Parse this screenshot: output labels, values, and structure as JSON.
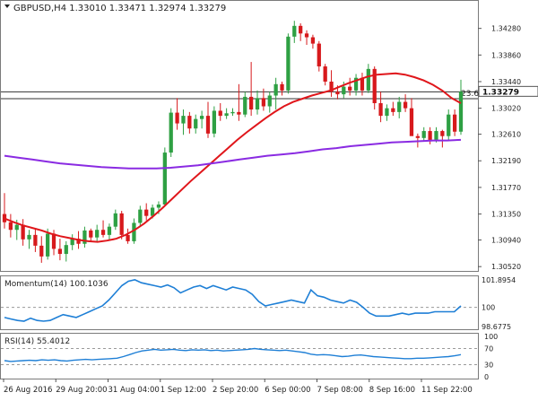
{
  "header": {
    "symbol_line": "GBPUSD,H4  1.33010 1.33471 1.32974 1.33279"
  },
  "fib_label": "23.6",
  "current_price": "1.33279",
  "price_axis": [
    "1.34280",
    "1.33860",
    "1.33440",
    "1.33020",
    "1.32610",
    "1.32190",
    "1.31770",
    "1.31350",
    "1.30940",
    "1.30520"
  ],
  "time_axis": [
    "26 Aug 2016",
    "29 Aug 20:00",
    "31 Aug 04:00",
    "1 Sep 12:00",
    "2 Sep 20:00",
    "6 Sep 00:00",
    "7 Sep 08:00",
    "8 Sep 16:00",
    "11 Sep 22:00"
  ],
  "momentum": {
    "label": "Momentum(14) 100.1036",
    "axis": [
      "101.8954",
      "100",
      "98.6775"
    ]
  },
  "rsi": {
    "label": "RSI(14) 55.4012",
    "axis": [
      "100",
      "70",
      "30",
      "0"
    ]
  },
  "colors": {
    "bull": "#2ea043",
    "bear": "#d7191c",
    "sma_fast": "#e0161b",
    "sma_slow": "#8a2be2",
    "indicator": "#1e7fd6",
    "grid": "#9a9a9a",
    "axis_text": "#222222"
  },
  "chart_data": [
    {
      "type": "candlestick",
      "title": "GBPUSD,H4",
      "ohlc_header": {
        "open": 1.3301,
        "high": 1.33471,
        "low": 1.32974,
        "close": 1.33279
      },
      "ylim": [
        1.3048,
        1.347
      ],
      "y_ticks": [
        1.3428,
        1.3386,
        1.3344,
        1.3302,
        1.3261,
        1.3219,
        1.3177,
        1.3135,
        1.3094,
        1.3052
      ],
      "x_tick_labels": [
        "26 Aug 2016",
        "29 Aug 20:00",
        "31 Aug 04:00",
        "1 Sep 12:00",
        "2 Sep 20:00",
        "6 Sep 00:00",
        "7 Sep 08:00",
        "8 Sep 16:00",
        "11 Sep 22:00"
      ],
      "fib_level": {
        "label": "23.6",
        "value": 1.3317
      },
      "last_price_line": 1.33279,
      "candles": [
        [
          1.3135,
          1.3168,
          1.3112,
          1.3122
        ],
        [
          1.3122,
          1.3135,
          1.3098,
          1.311
        ],
        [
          1.311,
          1.3126,
          1.3094,
          1.3118
        ],
        [
          1.3118,
          1.3127,
          1.3085,
          1.3095
        ],
        [
          1.3095,
          1.311,
          1.308,
          1.3102
        ],
        [
          1.3102,
          1.3112,
          1.3075,
          1.3085
        ],
        [
          1.3085,
          1.31,
          1.3058,
          1.3068
        ],
        [
          1.3068,
          1.3112,
          1.3063,
          1.3104
        ],
        [
          1.3104,
          1.311,
          1.307,
          1.308
        ],
        [
          1.308,
          1.3096,
          1.3062,
          1.3072
        ],
        [
          1.3072,
          1.3092,
          1.306,
          1.3086
        ],
        [
          1.3086,
          1.3103,
          1.3078,
          1.3096
        ],
        [
          1.3096,
          1.3108,
          1.308,
          1.3088
        ],
        [
          1.3088,
          1.3115,
          1.3082,
          1.3109
        ],
        [
          1.3109,
          1.3112,
          1.3092,
          1.3098
        ],
        [
          1.3098,
          1.3118,
          1.309,
          1.311
        ],
        [
          1.311,
          1.3125,
          1.3098,
          1.3102
        ],
        [
          1.3102,
          1.312,
          1.3094,
          1.3115
        ],
        [
          1.3115,
          1.3142,
          1.311,
          1.3136
        ],
        [
          1.3136,
          1.314,
          1.3095,
          1.3102
        ],
        [
          1.3102,
          1.3112,
          1.3088,
          1.3092
        ],
        [
          1.3092,
          1.3128,
          1.3088,
          1.3121
        ],
        [
          1.3121,
          1.3148,
          1.3115,
          1.3142
        ],
        [
          1.3142,
          1.3152,
          1.3125,
          1.3132
        ],
        [
          1.3132,
          1.315,
          1.3128,
          1.3145
        ],
        [
          1.3145,
          1.3155,
          1.3135,
          1.315
        ],
        [
          1.315,
          1.324,
          1.3148,
          1.3232
        ],
        [
          1.3232,
          1.3302,
          1.3225,
          1.3295
        ],
        [
          1.3295,
          1.3318,
          1.3268,
          1.3278
        ],
        [
          1.3278,
          1.33,
          1.326,
          1.329
        ],
        [
          1.329,
          1.3296,
          1.3262,
          1.327
        ],
        [
          1.327,
          1.3292,
          1.3262,
          1.3285
        ],
        [
          1.3285,
          1.3298,
          1.327,
          1.329
        ],
        [
          1.329,
          1.3312,
          1.3255,
          1.3262
        ],
        [
          1.3262,
          1.3305,
          1.3256,
          1.3298
        ],
        [
          1.3298,
          1.331,
          1.3282,
          1.329
        ],
        [
          1.329,
          1.3302,
          1.3285,
          1.3294
        ],
        [
          1.3294,
          1.3302,
          1.329,
          1.3296
        ],
        [
          1.3296,
          1.334,
          1.3282,
          1.3292
        ],
        [
          1.3292,
          1.3328,
          1.3288,
          1.332
        ],
        [
          1.332,
          1.3375,
          1.329,
          1.33
        ],
        [
          1.33,
          1.333,
          1.3292,
          1.3318
        ],
        [
          1.3318,
          1.3333,
          1.3298,
          1.3305
        ],
        [
          1.3305,
          1.3328,
          1.3295,
          1.3322
        ],
        [
          1.3322,
          1.335,
          1.33,
          1.334
        ],
        [
          1.334,
          1.3344,
          1.3322,
          1.333
        ],
        [
          1.333,
          1.342,
          1.3325,
          1.3415
        ],
        [
          1.3415,
          1.344,
          1.3405,
          1.3432
        ],
        [
          1.3432,
          1.3436,
          1.3408,
          1.342
        ],
        [
          1.342,
          1.3425,
          1.3402,
          1.3414
        ],
        [
          1.3414,
          1.3418,
          1.3396,
          1.3404
        ],
        [
          1.3404,
          1.3408,
          1.336,
          1.3368
        ],
        [
          1.3368,
          1.3372,
          1.3338,
          1.3344
        ],
        [
          1.3344,
          1.3362,
          1.332,
          1.3328
        ],
        [
          1.3328,
          1.3338,
          1.3316,
          1.3324
        ],
        [
          1.3324,
          1.3344,
          1.3318,
          1.3336
        ],
        [
          1.3336,
          1.335,
          1.3322,
          1.333
        ],
        [
          1.333,
          1.3356,
          1.3322,
          1.335
        ],
        [
          1.335,
          1.3358,
          1.3322,
          1.333
        ],
        [
          1.333,
          1.3372,
          1.3326,
          1.3364
        ],
        [
          1.3364,
          1.3368,
          1.33,
          1.331
        ],
        [
          1.331,
          1.3328,
          1.328,
          1.329
        ],
        [
          1.329,
          1.3308,
          1.3282,
          1.3302
        ],
        [
          1.3302,
          1.3312,
          1.329,
          1.3296
        ],
        [
          1.3296,
          1.332,
          1.3286,
          1.3312
        ],
        [
          1.3312,
          1.3324,
          1.3296,
          1.3302
        ],
        [
          1.3302,
          1.3318,
          1.327,
          1.3258
        ],
        [
          1.3258,
          1.3262,
          1.324,
          1.3255
        ],
        [
          1.3255,
          1.3272,
          1.325,
          1.3266
        ],
        [
          1.3266,
          1.3272,
          1.3245,
          1.3252
        ],
        [
          1.3252,
          1.3272,
          1.3248,
          1.3266
        ],
        [
          1.3266,
          1.3268,
          1.324,
          1.3258
        ],
        [
          1.3258,
          1.33,
          1.325,
          1.3292
        ],
        [
          1.3292,
          1.33,
          1.3258,
          1.3265
        ],
        [
          1.3265,
          1.3347,
          1.326,
          1.3328
        ]
      ],
      "series": [
        {
          "values": [
            1.3128,
            1.3122,
            1.3117,
            1.3113,
            1.3109,
            1.3104,
            1.31,
            1.3097,
            1.3094,
            1.3092,
            1.3091,
            1.3093,
            1.3096,
            1.3102,
            1.311,
            1.312,
            1.3132,
            1.3145,
            1.3159,
            1.3173,
            1.3187,
            1.32,
            1.3213,
            1.3226,
            1.3239,
            1.3252,
            1.3264,
            1.3275,
            1.3286,
            1.3296,
            1.3305,
            1.3312,
            1.3317,
            1.3322,
            1.3326,
            1.333,
            1.3336,
            1.3342,
            1.3347,
            1.3352,
            1.3355,
            1.3356,
            1.3357,
            1.3355,
            1.3351,
            1.3346,
            1.3339,
            1.333,
            1.3318,
            1.331
          ]
        },
        {
          "values": [
            1.3227,
            1.3224,
            1.3221,
            1.3218,
            1.3215,
            1.3213,
            1.3211,
            1.3209,
            1.3208,
            1.3207,
            1.3207,
            1.3207,
            1.3208,
            1.321,
            1.3212,
            1.3215,
            1.3218,
            1.3221,
            1.3224,
            1.3227,
            1.3229,
            1.3231,
            1.3234,
            1.3237,
            1.3239,
            1.3242,
            1.3244,
            1.3246,
            1.3248,
            1.3249,
            1.325,
            1.3251,
            1.3251,
            1.3252
          ]
        }
      ]
    },
    {
      "type": "line",
      "title": "Momentum(14) 100.1036",
      "reference": 100,
      "ylim": [
        98.6775,
        101.8954
      ],
      "values": [
        99.3,
        99.2,
        99.1,
        99.05,
        99.25,
        99.1,
        99.05,
        99.1,
        99.3,
        99.5,
        99.4,
        99.3,
        99.5,
        99.7,
        99.9,
        100.1,
        100.5,
        101.0,
        101.5,
        101.8,
        101.9,
        101.7,
        101.6,
        101.5,
        101.4,
        101.55,
        101.35,
        101.0,
        101.2,
        101.4,
        101.5,
        101.3,
        101.5,
        101.35,
        101.2,
        101.4,
        101.3,
        101.2,
        100.9,
        100.4,
        100.1,
        100.2,
        100.3,
        100.4,
        100.5,
        100.4,
        100.3,
        101.2,
        100.8,
        100.7,
        100.5,
        100.4,
        100.3,
        100.5,
        100.35,
        100.0,
        99.6,
        99.4,
        99.4,
        99.4,
        99.5,
        99.6,
        99.5,
        99.6,
        99.6,
        99.6,
        99.7,
        99.7,
        99.7,
        99.7,
        100.1
      ]
    },
    {
      "type": "line",
      "title": "RSI(14) 55.4012",
      "ylim": [
        0,
        100
      ],
      "levels": [
        70,
        30
      ],
      "values": [
        40,
        38,
        39,
        40,
        41,
        40,
        42,
        41,
        42,
        40,
        39,
        41,
        42,
        43,
        42,
        43,
        44,
        45,
        46,
        50,
        55,
        60,
        64,
        66,
        68,
        66,
        67,
        68,
        66,
        65,
        67,
        66,
        67,
        65,
        66,
        64,
        65,
        66,
        67,
        68,
        70,
        68,
        67,
        66,
        65,
        66,
        64,
        62,
        60,
        56,
        54,
        55,
        54,
        52,
        50,
        51,
        53,
        54,
        52,
        50,
        49,
        48,
        47,
        46,
        45,
        45,
        46,
        46,
        47,
        48,
        49,
        50,
        52,
        55
      ]
    }
  ]
}
